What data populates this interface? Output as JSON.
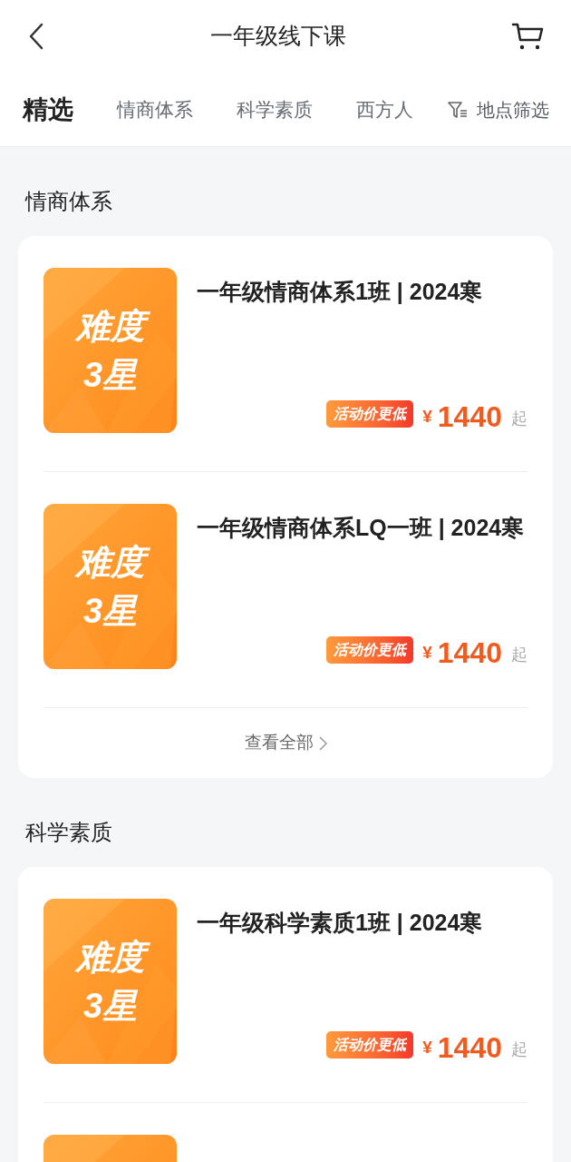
{
  "header": {
    "title": "一年级线下课"
  },
  "tabs": [
    {
      "label": "精选",
      "selected": true
    },
    {
      "label": "情商体系",
      "selected": false
    },
    {
      "label": "科学素质",
      "selected": false
    },
    {
      "label": "西方人",
      "selected": false
    }
  ],
  "filter": {
    "label": "地点筛选"
  },
  "sections": [
    {
      "title": "情商体系",
      "courses": [
        {
          "cover_lines": [
            "难度",
            "3星"
          ],
          "title": "一年级情商体系1班 | 2024寒",
          "promo": "活动价更低",
          "currency": "¥",
          "price": "1440",
          "suffix": "起"
        },
        {
          "cover_lines": [
            "难度",
            "3星"
          ],
          "title": "一年级情商体系LQ一班 | 2024寒",
          "promo": "活动价更低",
          "currency": "¥",
          "price": "1440",
          "suffix": "起"
        }
      ],
      "more": "查看全部"
    },
    {
      "title": "科学素质",
      "courses": [
        {
          "cover_lines": [
            "难度",
            "3星"
          ],
          "title": "一年级科学素质1班 | 2024寒",
          "promo": "活动价更低",
          "currency": "¥",
          "price": "1440",
          "suffix": "起"
        }
      ],
      "next_item_peek": true
    }
  ]
}
